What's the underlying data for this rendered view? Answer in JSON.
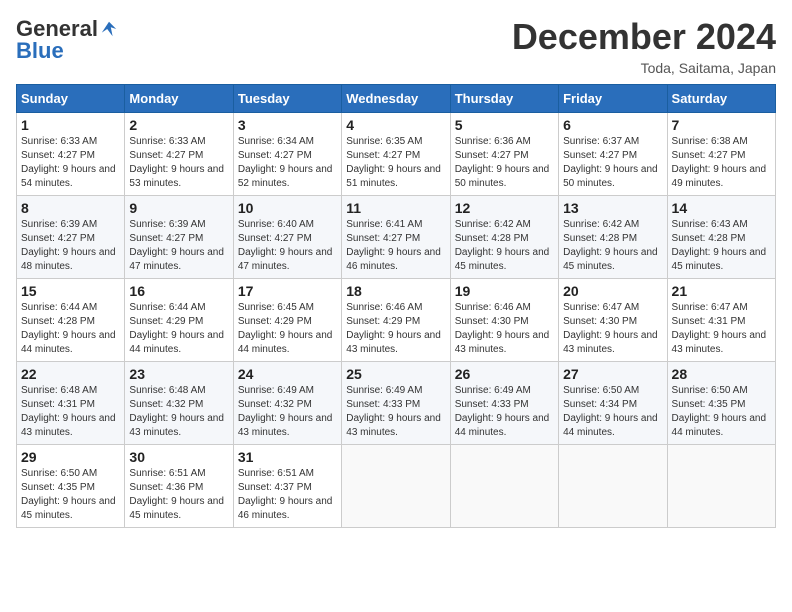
{
  "logo": {
    "general": "General",
    "blue": "Blue"
  },
  "title": "December 2024",
  "subtitle": "Toda, Saitama, Japan",
  "days_of_week": [
    "Sunday",
    "Monday",
    "Tuesday",
    "Wednesday",
    "Thursday",
    "Friday",
    "Saturday"
  ],
  "weeks": [
    [
      {
        "day": 1,
        "rise": "6:33 AM",
        "set": "4:27 PM",
        "daylight": "9 hours and 54 minutes."
      },
      {
        "day": 2,
        "rise": "6:33 AM",
        "set": "4:27 PM",
        "daylight": "9 hours and 53 minutes."
      },
      {
        "day": 3,
        "rise": "6:34 AM",
        "set": "4:27 PM",
        "daylight": "9 hours and 52 minutes."
      },
      {
        "day": 4,
        "rise": "6:35 AM",
        "set": "4:27 PM",
        "daylight": "9 hours and 51 minutes."
      },
      {
        "day": 5,
        "rise": "6:36 AM",
        "set": "4:27 PM",
        "daylight": "9 hours and 50 minutes."
      },
      {
        "day": 6,
        "rise": "6:37 AM",
        "set": "4:27 PM",
        "daylight": "9 hours and 50 minutes."
      },
      {
        "day": 7,
        "rise": "6:38 AM",
        "set": "4:27 PM",
        "daylight": "9 hours and 49 minutes."
      }
    ],
    [
      {
        "day": 8,
        "rise": "6:39 AM",
        "set": "4:27 PM",
        "daylight": "9 hours and 48 minutes."
      },
      {
        "day": 9,
        "rise": "6:39 AM",
        "set": "4:27 PM",
        "daylight": "9 hours and 47 minutes."
      },
      {
        "day": 10,
        "rise": "6:40 AM",
        "set": "4:27 PM",
        "daylight": "9 hours and 47 minutes."
      },
      {
        "day": 11,
        "rise": "6:41 AM",
        "set": "4:27 PM",
        "daylight": "9 hours and 46 minutes."
      },
      {
        "day": 12,
        "rise": "6:42 AM",
        "set": "4:28 PM",
        "daylight": "9 hours and 45 minutes."
      },
      {
        "day": 13,
        "rise": "6:42 AM",
        "set": "4:28 PM",
        "daylight": "9 hours and 45 minutes."
      },
      {
        "day": 14,
        "rise": "6:43 AM",
        "set": "4:28 PM",
        "daylight": "9 hours and 45 minutes."
      }
    ],
    [
      {
        "day": 15,
        "rise": "6:44 AM",
        "set": "4:28 PM",
        "daylight": "9 hours and 44 minutes."
      },
      {
        "day": 16,
        "rise": "6:44 AM",
        "set": "4:29 PM",
        "daylight": "9 hours and 44 minutes."
      },
      {
        "day": 17,
        "rise": "6:45 AM",
        "set": "4:29 PM",
        "daylight": "9 hours and 44 minutes."
      },
      {
        "day": 18,
        "rise": "6:46 AM",
        "set": "4:29 PM",
        "daylight": "9 hours and 43 minutes."
      },
      {
        "day": 19,
        "rise": "6:46 AM",
        "set": "4:30 PM",
        "daylight": "9 hours and 43 minutes."
      },
      {
        "day": 20,
        "rise": "6:47 AM",
        "set": "4:30 PM",
        "daylight": "9 hours and 43 minutes."
      },
      {
        "day": 21,
        "rise": "6:47 AM",
        "set": "4:31 PM",
        "daylight": "9 hours and 43 minutes."
      }
    ],
    [
      {
        "day": 22,
        "rise": "6:48 AM",
        "set": "4:31 PM",
        "daylight": "9 hours and 43 minutes."
      },
      {
        "day": 23,
        "rise": "6:48 AM",
        "set": "4:32 PM",
        "daylight": "9 hours and 43 minutes."
      },
      {
        "day": 24,
        "rise": "6:49 AM",
        "set": "4:32 PM",
        "daylight": "9 hours and 43 minutes."
      },
      {
        "day": 25,
        "rise": "6:49 AM",
        "set": "4:33 PM",
        "daylight": "9 hours and 43 minutes."
      },
      {
        "day": 26,
        "rise": "6:49 AM",
        "set": "4:33 PM",
        "daylight": "9 hours and 44 minutes."
      },
      {
        "day": 27,
        "rise": "6:50 AM",
        "set": "4:34 PM",
        "daylight": "9 hours and 44 minutes."
      },
      {
        "day": 28,
        "rise": "6:50 AM",
        "set": "4:35 PM",
        "daylight": "9 hours and 44 minutes."
      }
    ],
    [
      {
        "day": 29,
        "rise": "6:50 AM",
        "set": "4:35 PM",
        "daylight": "9 hours and 45 minutes."
      },
      {
        "day": 30,
        "rise": "6:51 AM",
        "set": "4:36 PM",
        "daylight": "9 hours and 45 minutes."
      },
      {
        "day": 31,
        "rise": "6:51 AM",
        "set": "4:37 PM",
        "daylight": "9 hours and 46 minutes."
      },
      null,
      null,
      null,
      null
    ]
  ]
}
